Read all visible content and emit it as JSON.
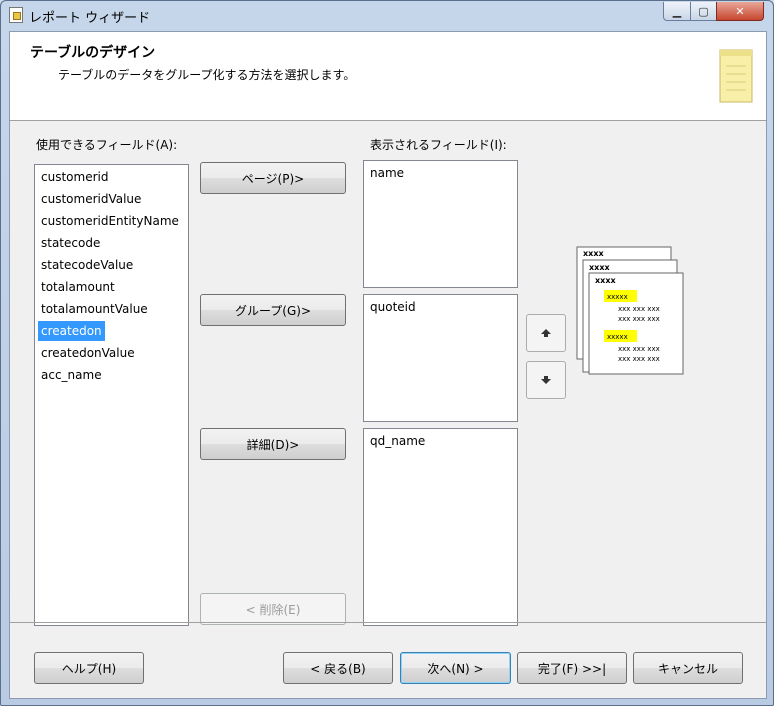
{
  "window": {
    "title": "レポート ウィザード"
  },
  "header": {
    "title": "テーブルのデザイン",
    "subtitle": "テーブルのデータをグループ化する方法を選択します。"
  },
  "available": {
    "label": "使用できるフィールド(A):",
    "items": [
      "customerid",
      "customeridValue",
      "customeridEntityName",
      "statecode",
      "statecodeValue",
      "totalamount",
      "totalamountValue",
      "createdon",
      "createdonValue",
      "acc_name"
    ],
    "selected": "createdon"
  },
  "displayed": {
    "label": "表示されるフィールド(I):",
    "page_items": [
      "name"
    ],
    "group_items": [
      "quoteid"
    ],
    "detail_items": [
      "qd_name"
    ]
  },
  "actions": {
    "page": "ページ(P)>",
    "group": "グループ(G)>",
    "detail": "詳細(D)>",
    "remove": "< 削除(E)"
  },
  "preview": {
    "header_text": "xxxx",
    "group_text": "xxxxx",
    "row_text": "xxx xxx xxx"
  },
  "footer": {
    "help": "ヘルプ(H)",
    "back": "< 戻る(B)",
    "next": "次へ(N) >",
    "finish": "完了(F) >>|",
    "cancel": "キャンセル"
  },
  "colors": {
    "selection": "#3399ff",
    "preview_highlight": "#ffff00"
  }
}
